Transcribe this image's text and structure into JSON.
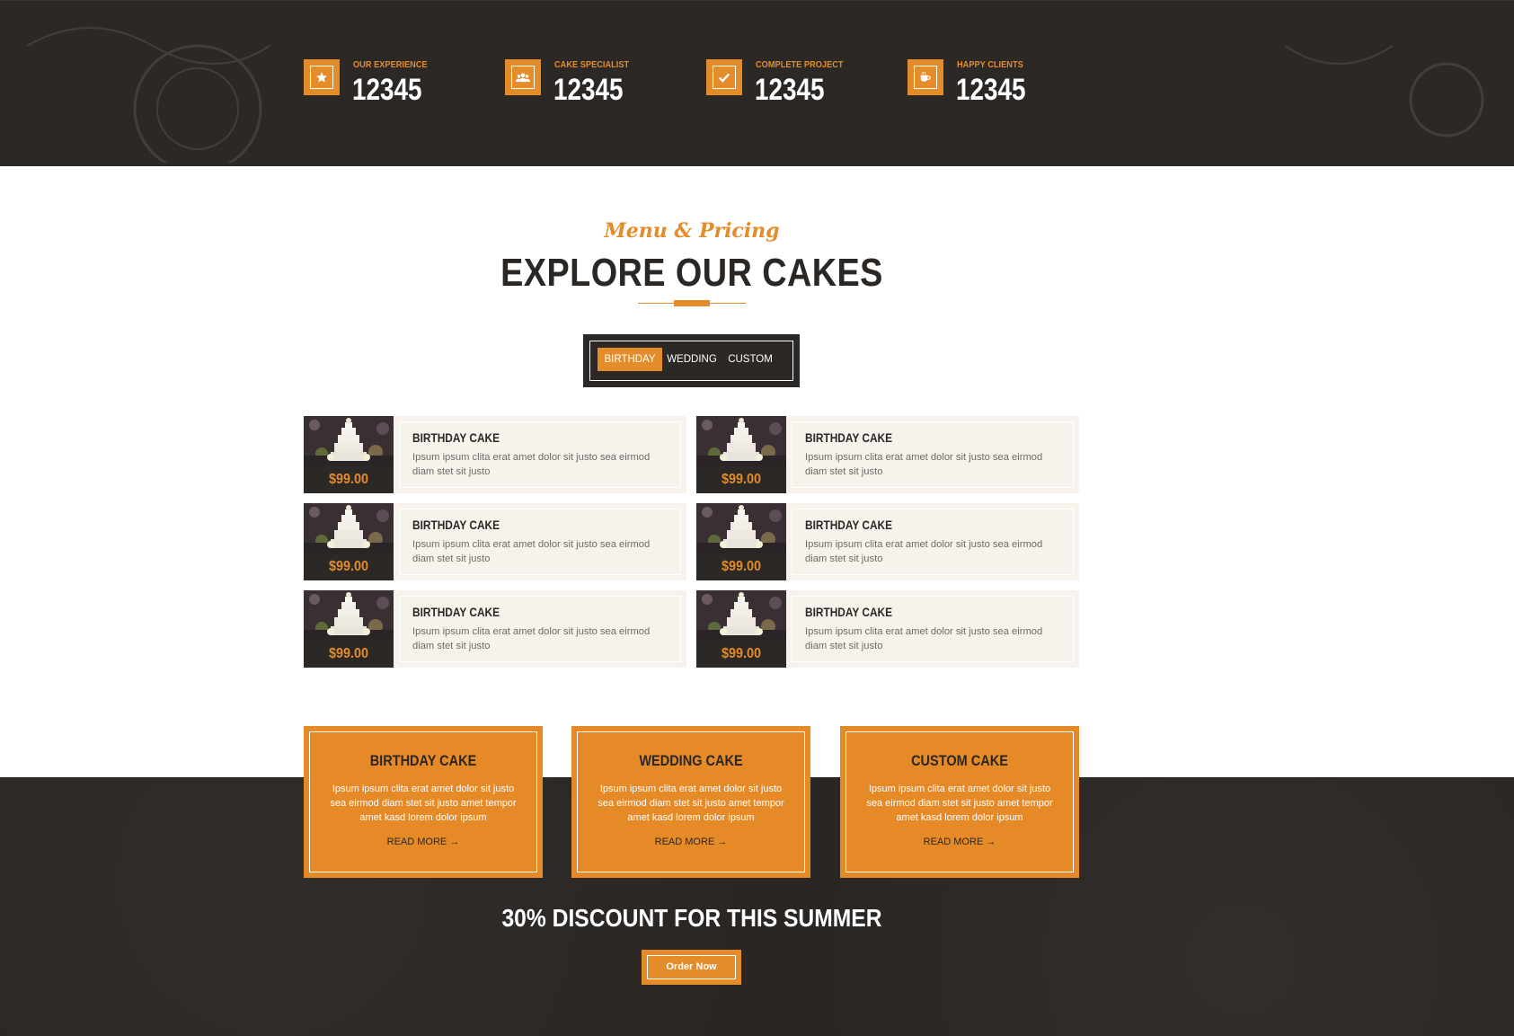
{
  "colors": {
    "accent": "#e48b2a",
    "dark": "#2b2826",
    "cream": "#f7f2ec",
    "white": "#ffffff"
  },
  "stats": [
    {
      "icon": "star-icon",
      "label": "OUR EXPERIENCE",
      "value": "12345"
    },
    {
      "icon": "users-icon",
      "label": "CAKE SPECIALIST",
      "value": "12345"
    },
    {
      "icon": "check-icon",
      "label": "COMPLETE PROJECT",
      "value": "12345"
    },
    {
      "icon": "coffee-icon",
      "label": "HAPPY CLIENTS",
      "value": "12345"
    }
  ],
  "section": {
    "subtitle": "Menu & Pricing",
    "title": "EXPLORE OUR CAKES"
  },
  "tabs": [
    {
      "label": "BIRTHDAY",
      "active": true
    },
    {
      "label": "WEDDING",
      "active": false
    },
    {
      "label": "CUSTOM",
      "active": false
    }
  ],
  "menu_items": [
    {
      "name": "BIRTHDAY CAKE",
      "description": "Ipsum ipsum clita erat amet dolor sit justo sea eirmod diam stet sit justo",
      "price": "$99.00",
      "image": "tiered-wedding-cake-photo"
    },
    {
      "name": "BIRTHDAY CAKE",
      "description": "Ipsum ipsum clita erat amet dolor sit justo sea eirmod diam stet sit justo",
      "price": "$99.00",
      "image": "tiered-wedding-cake-photo"
    },
    {
      "name": "BIRTHDAY CAKE",
      "description": "Ipsum ipsum clita erat amet dolor sit justo sea eirmod diam stet sit justo",
      "price": "$99.00",
      "image": "tiered-wedding-cake-photo"
    },
    {
      "name": "BIRTHDAY CAKE",
      "description": "Ipsum ipsum clita erat amet dolor sit justo sea eirmod diam stet sit justo",
      "price": "$99.00",
      "image": "tiered-wedding-cake-photo"
    },
    {
      "name": "BIRTHDAY CAKE",
      "description": "Ipsum ipsum clita erat amet dolor sit justo sea eirmod diam stet sit justo",
      "price": "$99.00",
      "image": "tiered-wedding-cake-photo"
    },
    {
      "name": "BIRTHDAY CAKE",
      "description": "Ipsum ipsum clita erat amet dolor sit justo sea eirmod diam stet sit justo",
      "price": "$99.00",
      "image": "tiered-wedding-cake-photo"
    }
  ],
  "cards": [
    {
      "name": "BIRTHDAY CAKE",
      "description": "Ipsum ipsum clita erat amet dolor sit justo sea eirmod diam stet sit justo amet tempor amet kasd lorem dolor ipsum",
      "link": "READ MORE →"
    },
    {
      "name": "WEDDING CAKE",
      "description": "Ipsum ipsum clita erat amet dolor sit justo sea eirmod diam stet sit justo amet tempor amet kasd lorem dolor ipsum",
      "link": "READ MORE →"
    },
    {
      "name": "CUSTOM CAKE",
      "description": "Ipsum ipsum clita erat amet dolor sit justo sea eirmod diam stet sit justo amet tempor amet kasd lorem dolor ipsum",
      "link": "READ MORE →"
    }
  ],
  "promo": {
    "headline": "30% DISCOUNT FOR THIS SUMMER",
    "button": "Order Now"
  }
}
